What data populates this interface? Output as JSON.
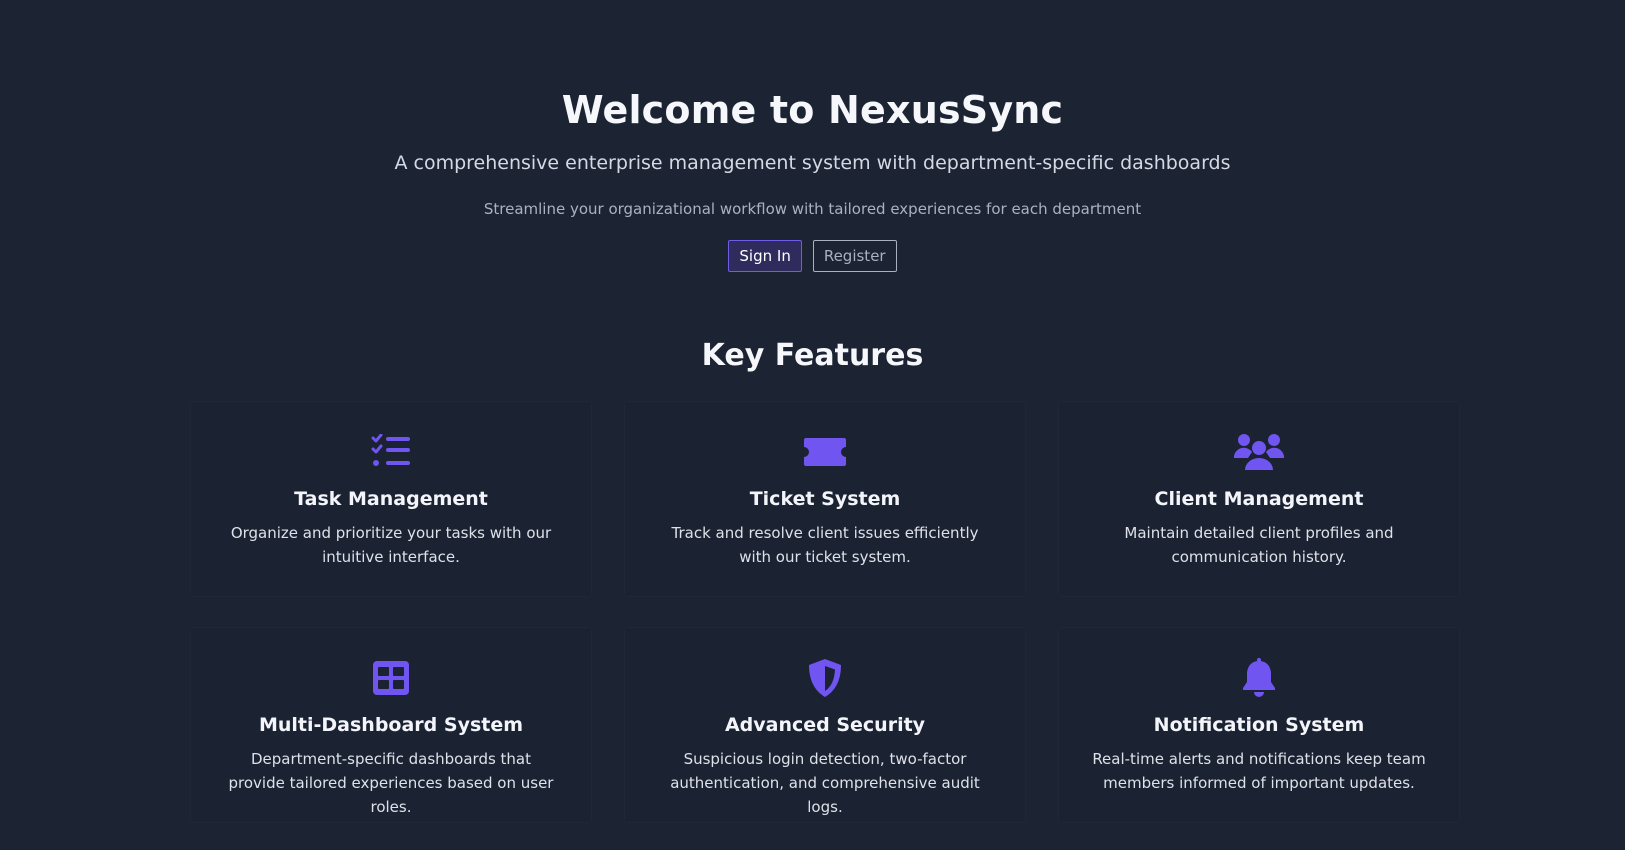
{
  "hero": {
    "title": "Welcome to NexusSync",
    "subtitle": "A comprehensive enterprise management system with department-specific dashboards",
    "tagline": "Streamline your organizational workflow with tailored experiences for each department",
    "sign_in_label": "Sign In",
    "register_label": "Register"
  },
  "features": {
    "heading": "Key Features",
    "accent_color": "#7055f0",
    "items": [
      {
        "icon": "task-list-icon",
        "title": "Task Management",
        "description": "Organize and prioritize your tasks with our intuitive interface."
      },
      {
        "icon": "ticket-icon",
        "title": "Ticket System",
        "description": "Track and resolve client issues efficiently with our ticket system."
      },
      {
        "icon": "users-icon",
        "title": "Client Management",
        "description": "Maintain detailed client profiles and communication history."
      },
      {
        "icon": "dashboard-grid-icon",
        "title": "Multi-Dashboard System",
        "description": "Department-specific dashboards that provide tailored experiences based on user roles."
      },
      {
        "icon": "shield-icon",
        "title": "Advanced Security",
        "description": "Suspicious login detection, two-factor authentication, and comprehensive audit logs."
      },
      {
        "icon": "bell-icon",
        "title": "Notification System",
        "description": "Real-time alerts and notifications keep team members informed of important updates."
      }
    ]
  }
}
